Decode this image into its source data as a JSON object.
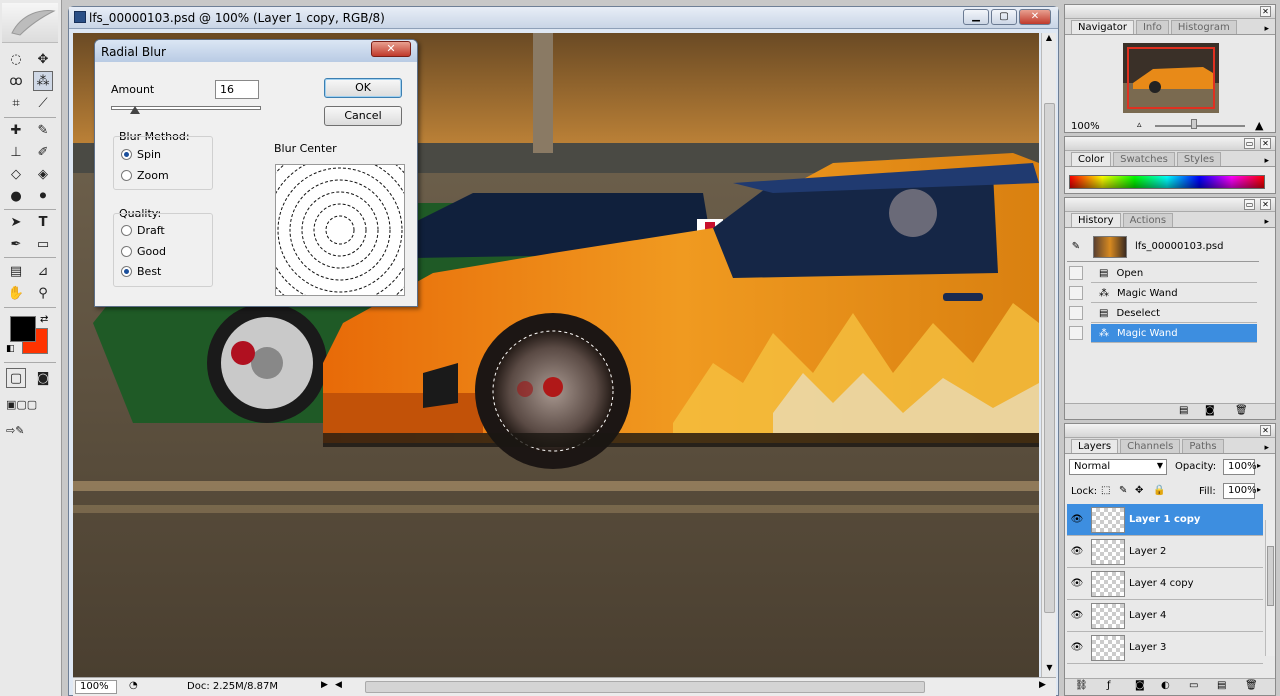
{
  "document": {
    "title": "lfs_00000103.psd @ 100% (Layer 1 copy, RGB/8)",
    "status_zoom": "100%",
    "status_doc": "Doc: 2.25M/8.87M"
  },
  "radial_blur": {
    "title": "Radial Blur",
    "amount_label": "Amount",
    "amount_value": "16",
    "amount_slider_fraction": 0.16,
    "ok_label": "OK",
    "cancel_label": "Cancel",
    "blur_method_label": "Blur Method:",
    "methods": [
      "Spin",
      "Zoom"
    ],
    "selected_method": "Spin",
    "quality_label": "Quality:",
    "qualities": [
      "Draft",
      "Good",
      "Best"
    ],
    "selected_quality": "Best",
    "blur_center_label": "Blur Center"
  },
  "navigator": {
    "tabs": [
      "Navigator",
      "Info",
      "Histogram"
    ],
    "active_tab": "Navigator",
    "zoom": "100%"
  },
  "color_panel": {
    "tabs": [
      "Color",
      "Swatches",
      "Styles"
    ],
    "active_tab": "Color"
  },
  "history": {
    "tabs": [
      "History",
      "Actions"
    ],
    "active_tab": "History",
    "snapshot": "lfs_00000103.psd",
    "items": [
      {
        "label": "Open",
        "icon": "document-icon"
      },
      {
        "label": "Magic Wand",
        "icon": "magic-wand-icon"
      },
      {
        "label": "Deselect",
        "icon": "document-icon"
      },
      {
        "label": "Magic Wand",
        "icon": "magic-wand-icon"
      }
    ],
    "selected_index": 3
  },
  "layers": {
    "tabs": [
      "Layers",
      "Channels",
      "Paths"
    ],
    "active_tab": "Layers",
    "blend_mode": "Normal",
    "opacity_label": "Opacity:",
    "opacity": "100%",
    "lock_label": "Lock:",
    "fill_label": "Fill:",
    "fill": "100%",
    "items": [
      "Layer 1 copy",
      "Layer 2",
      "Layer 4 copy",
      "Layer 4",
      "Layer 3"
    ],
    "selected_index": 0
  },
  "colors": {
    "foreground": "#000000",
    "background": "#ff3300",
    "selection": "#3d8ee0"
  }
}
